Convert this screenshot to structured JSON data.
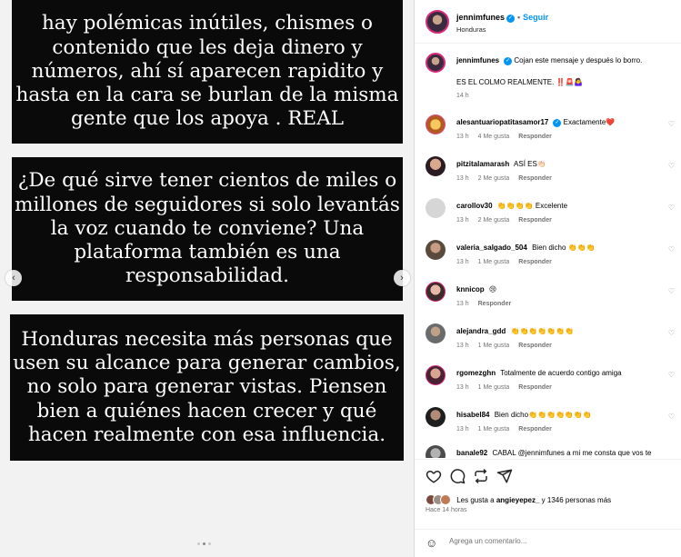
{
  "media": {
    "block1": "hay polémicas inútiles, chismes o\ncontenido que les deja dinero y\nnúmeros, ahí sí aparecen rapidito y\nhasta en la cara se burlan de la misma\ngente que los apoya . REAL",
    "block2": "¿De qué sirve tener cientos de miles o\nmillones de seguidores si solo levantás\nla voz cuando te conviene? Una\nplataforma también es una\nresponsabilidad.",
    "block3": "Honduras necesita más personas que\nusen su alcance para generar cambios,\nno solo para generar vistas. Piensen\nbien a quiénes hacen crecer y qué\nhacen realmente con esa influencia.",
    "prev_glyph": "‹",
    "next_glyph": "›"
  },
  "header": {
    "username": "jennimfunes",
    "follow": "Seguir",
    "location": "Honduras"
  },
  "caption": {
    "username": "jennimfunes",
    "text": "Cojan este mensaje y después lo borro.",
    "text2": "ES EL COLMO REALMENTE. ‼️🚨🤷‍♀️",
    "time": "14 h"
  },
  "comments": [
    {
      "user": "alesantuariopatitasamor17",
      "verified": true,
      "text": "Exactamente❤️",
      "time": "13 h",
      "likes": "4 Me gusta",
      "reply": "Responder"
    },
    {
      "user": "pitzitalamarash",
      "verified": false,
      "text": "ASÍ ES👏🏻",
      "time": "13 h",
      "likes": "2 Me gusta",
      "reply": "Responder"
    },
    {
      "user": "carollov30",
      "verified": false,
      "text": "👏👏👏👏 Excelente",
      "time": "13 h",
      "likes": "2 Me gusta",
      "reply": "Responder"
    },
    {
      "user": "valeria_salgado_504",
      "verified": false,
      "text": "Bien dicho 👏👏👏",
      "time": "13 h",
      "likes": "1 Me gusta",
      "reply": "Responder"
    },
    {
      "user": "knnicop",
      "verified": false,
      "text": "😢",
      "time": "13 h",
      "likes": "",
      "reply": "Responder"
    },
    {
      "user": "alejandra_gdd",
      "verified": false,
      "text": "👏👏👏👏👏👏👏",
      "time": "13 h",
      "likes": "1 Me gusta",
      "reply": "Responder"
    },
    {
      "user": "rgomezghn",
      "verified": false,
      "text": "Totalmente de acuerdo contigo amiga",
      "time": "13 h",
      "likes": "1 Me gusta",
      "reply": "Responder"
    },
    {
      "user": "hisabel84",
      "verified": false,
      "text": "Bien dicho👏👏👏👏👏👏👏",
      "time": "13 h",
      "likes": "1 Me gusta",
      "reply": "Responder"
    },
    {
      "user": "banale92",
      "verified": false,
      "text": "CABAL @jennimfunes a mi me consta que vos te",
      "time": "",
      "likes": "",
      "reply": ""
    }
  ],
  "footer": {
    "likes_prefix": "Les gusta a",
    "likes_user": "angieyepez_",
    "likes_suffix": "y 1346 personas más",
    "time": "Hace 14 horas",
    "comment_placeholder": "Agrega un comentario..."
  },
  "icons": [
    "heart-icon",
    "comment-icon",
    "share-icon",
    "send-icon",
    "verified-icon",
    "emoji-icon",
    "chevron-left-icon",
    "chevron-right-icon"
  ],
  "colors": {
    "accent": "#0095f6",
    "heart": "#ed4956",
    "muted": "#737373"
  }
}
